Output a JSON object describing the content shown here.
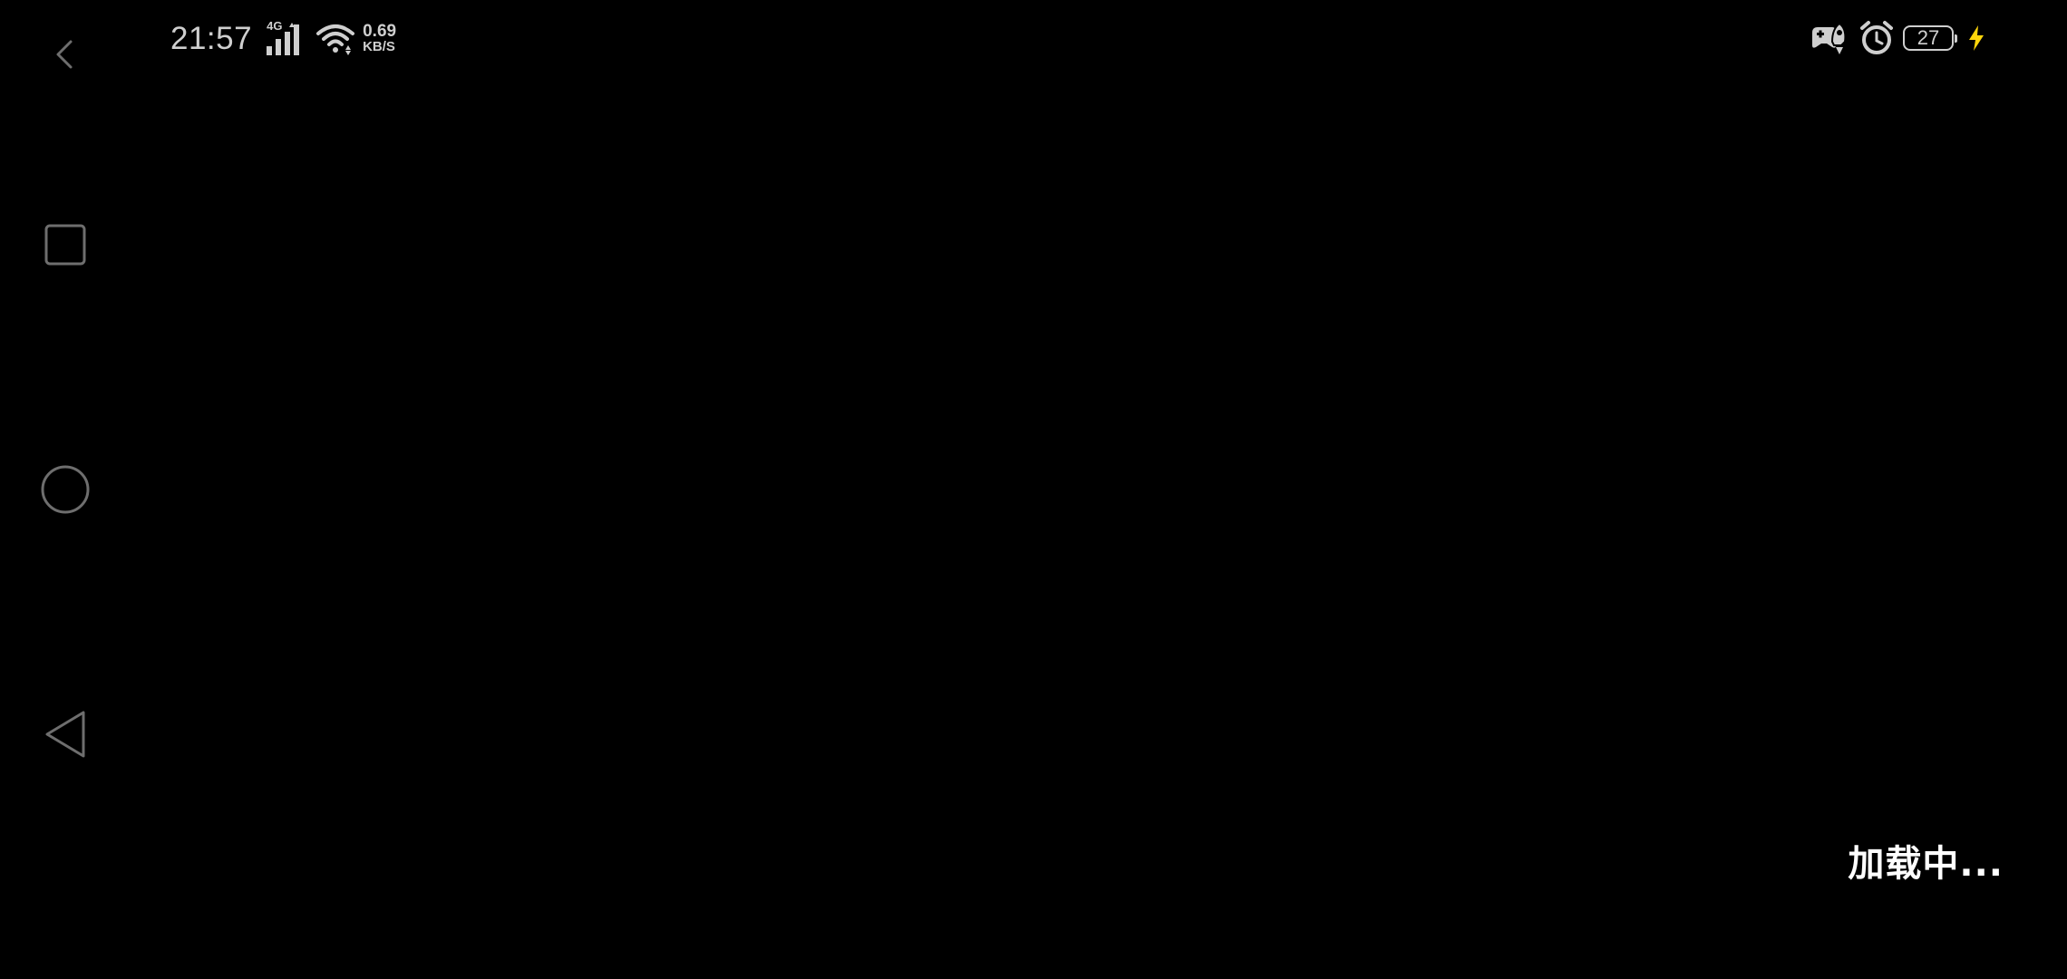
{
  "status_bar": {
    "time": "21:57",
    "network_type": "4G",
    "speed_value": "0.69",
    "speed_unit": "KB/S",
    "battery_level": "27",
    "icons": {
      "signal": "signal-bars-icon",
      "wifi": "wifi-icon",
      "game_mode": "game-controller-rocket-icon",
      "alarm": "alarm-clock-icon",
      "charging": "charging-bolt-icon"
    },
    "charging_color": "#ffd60a"
  },
  "nav_bar": {
    "icons": [
      "chevron-left-icon",
      "square-recents-icon",
      "circle-home-icon",
      "triangle-back-icon"
    ]
  },
  "main": {
    "loading_text": "加载中..."
  }
}
